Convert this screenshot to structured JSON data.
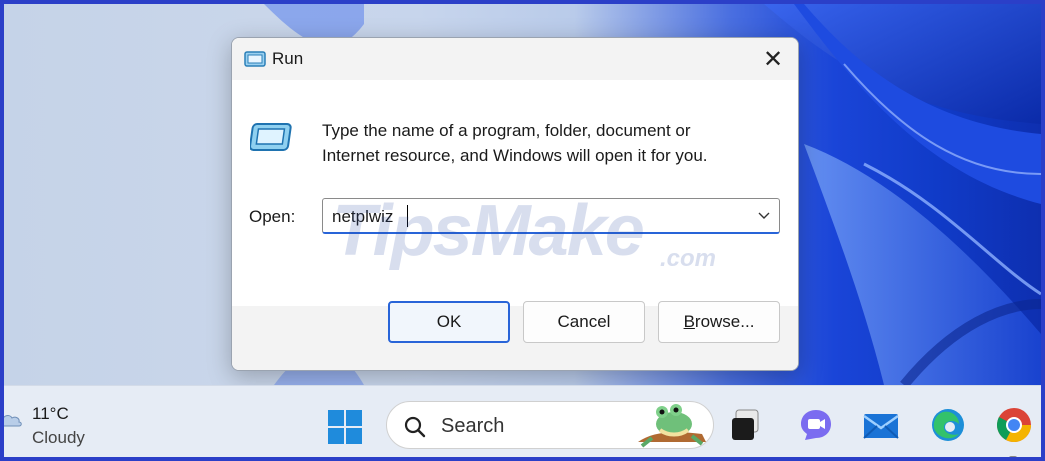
{
  "dialog": {
    "title": "Run",
    "description_line1": "Type the name of a program, folder, document or",
    "description_line2": "Internet resource, and Windows will open it for you.",
    "open_label": "Open:",
    "open_value": "netplwiz",
    "buttons": {
      "ok": "OK",
      "cancel": "Cancel",
      "browse_prefix": "B",
      "browse_rest": "rowse..."
    },
    "close_glyph": "✕"
  },
  "watermark": {
    "text": "TipsMake",
    "suffix": ".com"
  },
  "taskbar": {
    "weather": {
      "temperature": "11°C",
      "condition": "Cloudy"
    },
    "search_placeholder": "Search",
    "pinned_icons": [
      "start-icon",
      "task-view-icon",
      "teams-chat-icon",
      "mail-icon",
      "edge-icon",
      "chrome-icon"
    ]
  },
  "colors": {
    "accent": "#2864d8",
    "frame": "#2b3fc8",
    "taskbar": "#e6ecf5",
    "dialog_chrome": "#f3f3f3"
  }
}
